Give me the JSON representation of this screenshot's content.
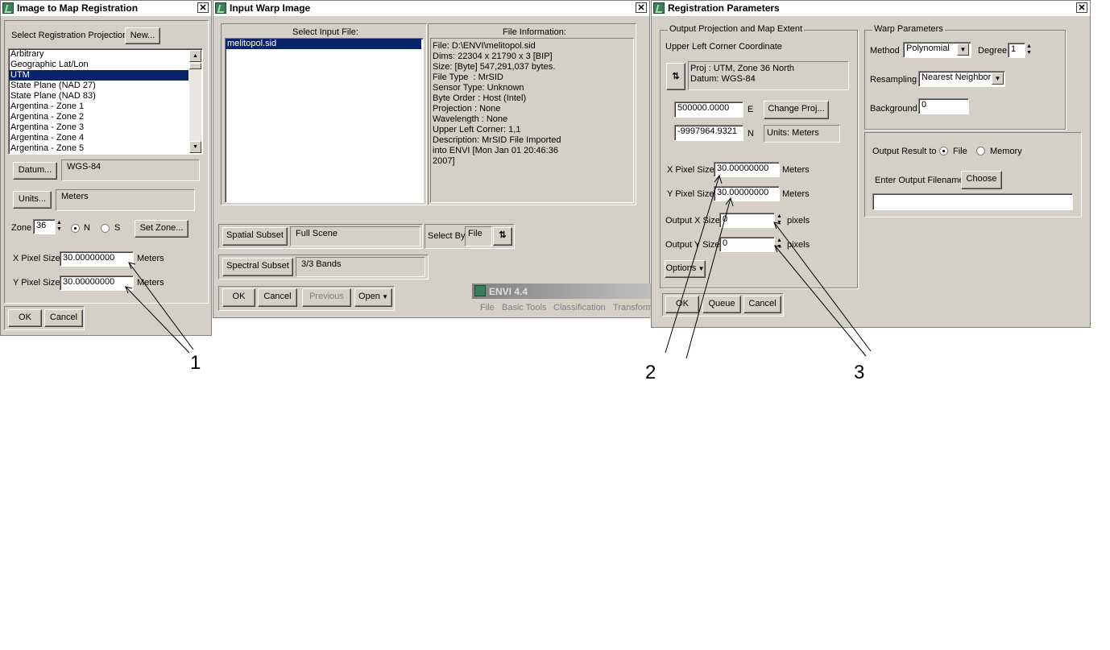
{
  "w1": {
    "title": "Image to Map Registration",
    "select_proj_label": "Select Registration Projection",
    "new_btn": "New...",
    "projections": [
      "Arbitrary",
      "Geographic Lat/Lon",
      "UTM",
      "State Plane (NAD 27)",
      "State Plane (NAD 83)",
      "Argentina - Zone 1",
      "Argentina - Zone 2",
      "Argentina - Zone 3",
      "Argentina - Zone 4",
      "Argentina - Zone 5"
    ],
    "datum_btn": "Datum...",
    "datum_value": "WGS-84",
    "units_btn": "Units...",
    "units_value": "Meters",
    "zone_label": "Zone",
    "zone_value": "36",
    "n_label": "N",
    "s_label": "S",
    "setzone_btn": "Set Zone...",
    "x_pixel_label": "X Pixel Size",
    "x_pixel_value": "30.00000000",
    "x_units": "Meters",
    "y_pixel_label": "Y Pixel Size",
    "y_pixel_value": "30.00000000",
    "y_units": "Meters",
    "ok": "OK",
    "cancel": "Cancel"
  },
  "w2": {
    "title": "Input Warp Image",
    "select_label": "Select Input File:",
    "files": [
      "melitopol.sid"
    ],
    "info_label": "File Information:",
    "info_lines": "File: D:\\ENVI\\melitopol.sid\nDims: 22304 x 21790 x 3 [BIP]\nSize: [Byte] 547,291,037 bytes.\nFile Type  : MrSID\nSensor Type: Unknown\nByte Order : Host (Intel)\nProjection : None\nWavelength : None\nUpper Left Corner: 1,1\nDescription: MrSID File Imported\ninto ENVI [Mon Jan 01 20:46:36\n2007]",
    "spatial_btn": "Spatial Subset",
    "spatial_value": "Full Scene",
    "selectby_label": "Select By",
    "selectby_value": "File",
    "spectral_btn": "Spectral Subset",
    "spectral_value": "3/3 Bands",
    "ok": "OK",
    "cancel": "Cancel",
    "previous": "Previous",
    "open": "Open"
  },
  "envi": {
    "title": "ENVI 4.4",
    "menu": [
      "File",
      "Basic Tools",
      "Classification",
      "Transform"
    ]
  },
  "w3": {
    "title": "Registration Parameters",
    "output_group": "Output Projection and Map Extent",
    "ul_label": "Upper Left Corner Coordinate",
    "proj_line": "Proj : UTM, Zone 36 North",
    "datum_line": "Datum: WGS-84",
    "e_value": "500000.0000",
    "e_label": "E",
    "change_proj": "Change Proj...",
    "n_value": "-9997964.9321",
    "n_label": "N",
    "units_text": "Units: Meters",
    "x_pixel_label": "X Pixel Size",
    "x_pixel_value": "30.00000000",
    "x_units": "Meters",
    "y_pixel_label": "Y Pixel Size",
    "y_pixel_value": "30.00000000",
    "y_units": "Meters",
    "out_x_label": "Output X Size",
    "out_x_value": "0",
    "out_x_units": "pixels",
    "out_y_label": "Output Y Size",
    "out_y_value": "0",
    "out_y_units": "pixels",
    "options": "Options",
    "warp_group": "Warp Parameters",
    "method_label": "Method",
    "method_value": "Polynomial",
    "degree_label": "Degree",
    "degree_value": "1",
    "resampling_label": "Resampling",
    "resampling_value": "Nearest Neighbor",
    "background_label": "Background",
    "background_value": "0",
    "output_to_label": "Output Result to",
    "file_label": "File",
    "memory_label": "Memory",
    "enter_filename_label": "Enter Output Filename",
    "choose_btn": "Choose",
    "filename_value": "",
    "ok": "OK",
    "queue": "Queue",
    "cancel": "Cancel"
  },
  "callouts": {
    "one": "1",
    "two": "2",
    "three": "3"
  }
}
